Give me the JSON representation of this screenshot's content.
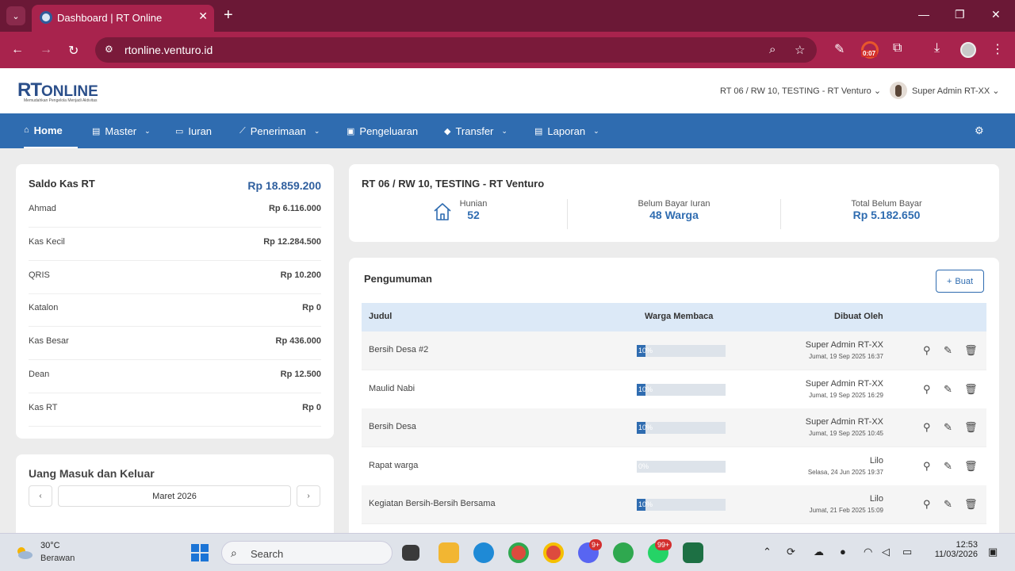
{
  "browser": {
    "tab_title": "Dashboard | RT Online",
    "url": "rtonline.venturo.id",
    "rec_time": "0:07"
  },
  "header": {
    "logo_rt": "RT",
    "logo_online": "ONLINE",
    "logo_tagline": "Memudahkan Pengelola Menjadi Aktivitas",
    "rt_select": "RT 06 / RW 10, TESTING - RT Venturo",
    "user_name": "Super Admin RT-XX"
  },
  "nav": {
    "home": "Home",
    "master": "Master",
    "iuran": "Iuran",
    "penerimaan": "Penerimaan",
    "pengeluaran": "Pengeluaran",
    "transfer": "Transfer",
    "laporan": "Laporan"
  },
  "saldo": {
    "title": "Saldo Kas RT",
    "total": "Rp 18.859.200",
    "rows": [
      {
        "label": "Ahmad",
        "value": "Rp 6.116.000"
      },
      {
        "label": "Kas Kecil",
        "value": "Rp 12.284.500"
      },
      {
        "label": "QRIS",
        "value": "Rp 10.200"
      },
      {
        "label": "Katalon",
        "value": "Rp 0"
      },
      {
        "label": "Kas Besar",
        "value": "Rp 436.000"
      },
      {
        "label": "Dean",
        "value": "Rp 12.500"
      },
      {
        "label": "Kas RT",
        "value": "Rp 0"
      }
    ]
  },
  "uang": {
    "title": "Uang Masuk dan Keluar",
    "month": "Maret 2026",
    "prev": "‹",
    "next": "›"
  },
  "rtinfo": {
    "title": "RT 06 / RW 10, TESTING - RT Venturo",
    "hunian_label": "Hunian",
    "hunian_value": "52",
    "belum_label": "Belum Bayar Iuran",
    "belum_value": "48 Warga",
    "total_label": "Total Belum Bayar",
    "total_value": "Rp 5.182.650"
  },
  "pengumuman": {
    "title": "Pengumuman",
    "buat_label": "Buat",
    "col_judul": "Judul",
    "col_warga": "Warga Membaca",
    "col_dibuat": "Dibuat Oleh",
    "rows": [
      {
        "judul": "Bersih Desa #2",
        "pct": "10%",
        "frac": 0.1,
        "by": "Super Admin RT-XX",
        "date": "Jumat, 19 Sep 2025 16:37"
      },
      {
        "judul": "Maulid Nabi",
        "pct": "10%",
        "frac": 0.1,
        "by": "Super Admin RT-XX",
        "date": "Jumat, 19 Sep 2025 16:29"
      },
      {
        "judul": "Bersih Desa",
        "pct": "10%",
        "frac": 0.1,
        "by": "Super Admin RT-XX",
        "date": "Jumat, 19 Sep 2025 10:45"
      },
      {
        "judul": "Rapat warga",
        "pct": "0%",
        "frac": 0.0,
        "by": "Lilo",
        "date": "Selasa, 24 Jun 2025 19:37"
      },
      {
        "judul": "Kegiatan Bersih-Bersih Bersama",
        "pct": "10%",
        "frac": 0.1,
        "by": "Lilo",
        "date": "Jumat, 21 Feb 2025 15:09"
      }
    ]
  },
  "taskbar": {
    "temp": "30°C",
    "condition": "Berawan",
    "search": "Search",
    "badge_discord": "9+",
    "badge_whatsapp": "99+",
    "time": "12:53",
    "date": "11/03/2026"
  },
  "colors": {
    "brand": "#2f6cb0",
    "chrome": "#a8234d"
  }
}
